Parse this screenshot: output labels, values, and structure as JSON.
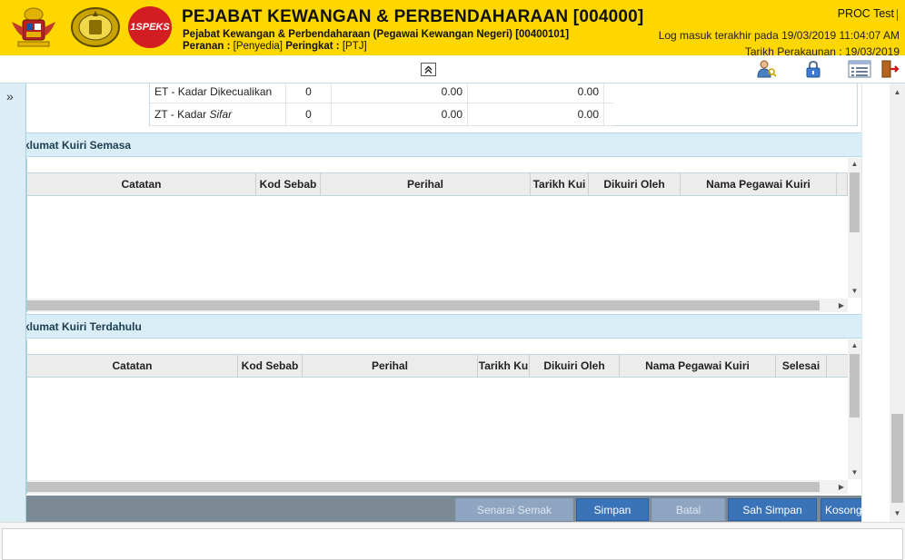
{
  "header": {
    "logo_text": "1SPEKS",
    "title": "PEJABAT KEWANGAN & PERBENDAHARAAN [004000]",
    "subtitle": "Pejabat Kewangan & Perbendaharaan (Pegawai Kewangan Negeri) [00400101]",
    "role_label": "Peranan :",
    "role_value": "[Penyedia]",
    "level_label": "Peringkat :",
    "level_value": "[PTJ]",
    "user": "PROC Test",
    "last_login": "Log masuk terakhir pada 19/03/2019 11:04:07 AM",
    "account_date": "Tarikh Perakaunan : 19/03/2019",
    "accent_color": "#ffd700"
  },
  "tax_rows": [
    {
      "code_text": "ET - Kadar Dikecualikan",
      "code_italic": "",
      "rate": "0",
      "amount": "0.00",
      "tax": "0.00"
    },
    {
      "code_text": "ZT - Kadar ",
      "code_italic": "Sifar",
      "rate": "0",
      "amount": "0.00",
      "tax": "0.00"
    }
  ],
  "current_query": {
    "title": "klumat Kuiri Semasa",
    "columns": [
      "Catatan",
      "Kod Sebab",
      "Perihal",
      "Tarikh Kui",
      "Dikuiri Oleh",
      "Nama Pegawai Kuiri"
    ],
    "rows": []
  },
  "previous_query": {
    "title": "klumat Kuiri Terdahulu",
    "columns": [
      "Catatan",
      "Kod Sebab",
      "Perihal",
      "Tarikh Ku",
      "Dikuiri Oleh",
      "Nama Pegawai Kuiri",
      "Selesai"
    ],
    "rows": []
  },
  "buttons": {
    "checklist": "Senarai Semak",
    "save": "Simpan",
    "cancel": "Batal",
    "confirm_save": "Sah Simpan",
    "clear": "Kosongkan"
  },
  "icons": {
    "expand": "double-chevron-right-icon",
    "collapse": "double-chevron-up-icon",
    "user_profile": "user-key-icon",
    "lock": "lock-icon",
    "list_view": "list-icon",
    "logout": "exit-door-icon"
  }
}
